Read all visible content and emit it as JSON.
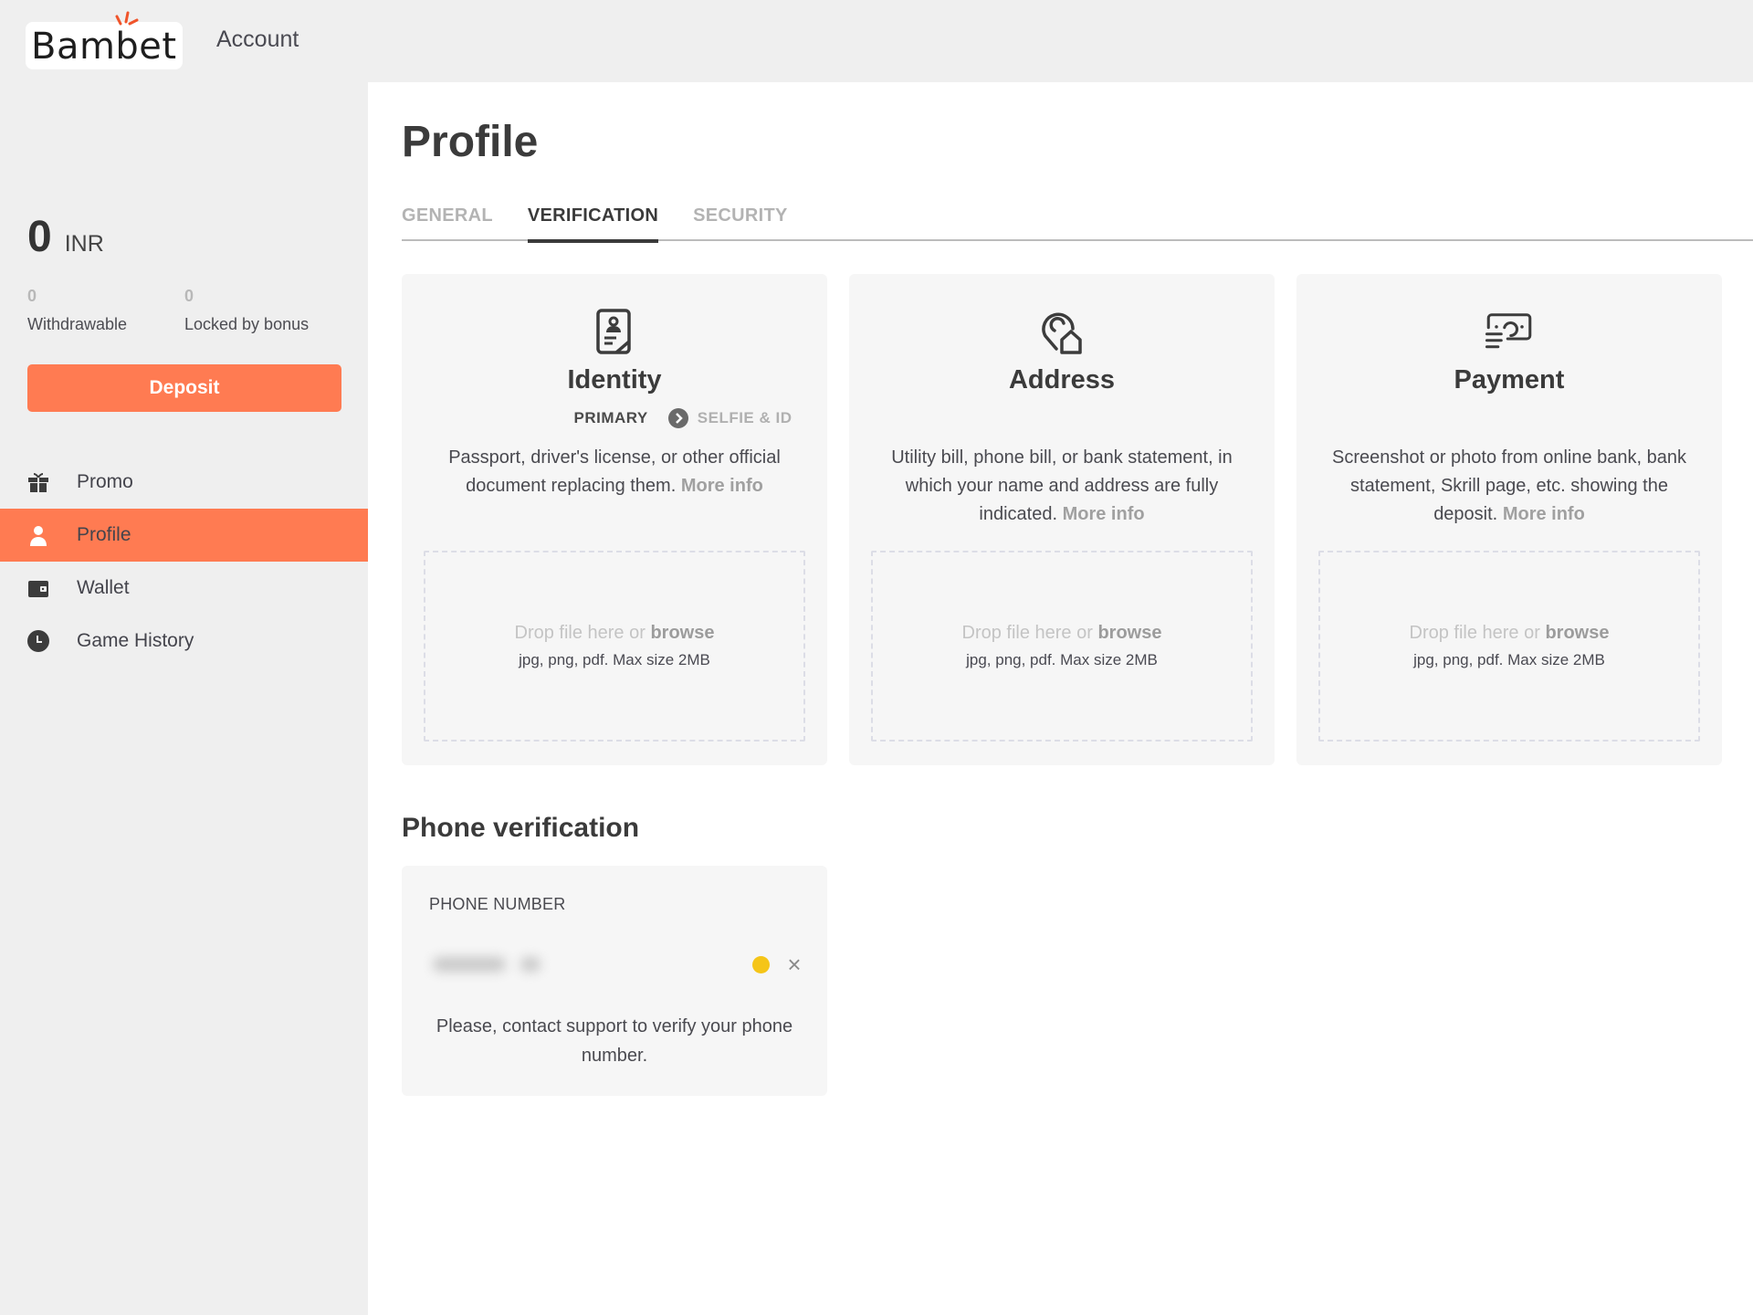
{
  "header": {
    "logo_text": "Bambet",
    "account_label": "Account"
  },
  "colors": {
    "accent": "#ff7b52",
    "pending_status": "#f5c518"
  },
  "sidebar": {
    "balance": {
      "amount": "0",
      "currency": "INR",
      "withdrawable_value": "0",
      "withdrawable_label": "Withdrawable",
      "locked_value": "0",
      "locked_label": "Locked by bonus"
    },
    "deposit_label": "Deposit",
    "items": [
      {
        "label": "Promo",
        "icon": "gift-icon",
        "active": false
      },
      {
        "label": "Profile",
        "icon": "user-icon",
        "active": true
      },
      {
        "label": "Wallet",
        "icon": "wallet-icon",
        "active": false
      },
      {
        "label": "Game History",
        "icon": "clock-icon",
        "active": false
      }
    ]
  },
  "main": {
    "title": "Profile",
    "tabs": [
      {
        "label": "GENERAL",
        "active": false
      },
      {
        "label": "VERIFICATION",
        "active": true
      },
      {
        "label": "SECURITY",
        "active": false
      }
    ],
    "cards": [
      {
        "icon": "id-document-icon",
        "title": "Identity",
        "step_primary": "PRIMARY",
        "step_secondary": "SELFIE & ID",
        "description": "Passport, driver's license, or other official document replacing them.",
        "more_info": "More info",
        "drop_text": "Drop file here or",
        "browse": "browse",
        "hint": "jpg, png, pdf. Max size 2MB"
      },
      {
        "icon": "location-home-icon",
        "title": "Address",
        "description": "Utility bill, phone bill, or bank statement, in which your name and address are fully indicated.",
        "more_info": "More info",
        "drop_text": "Drop file here or",
        "browse": "browse",
        "hint": "jpg, png, pdf. Max size 2MB"
      },
      {
        "icon": "payment-banknote-icon",
        "title": "Payment",
        "description": "Screenshot or photo from online bank, bank statement, Skrill page, etc. showing the deposit.",
        "more_info": "More info",
        "drop_text": "Drop file here or",
        "browse": "browse",
        "hint": "jpg, png, pdf. Max size 2MB"
      }
    ],
    "phone": {
      "section_title": "Phone verification",
      "label": "PHONE NUMBER",
      "value_hidden": "blurred",
      "message": "Please, contact support to verify your phone number."
    }
  }
}
